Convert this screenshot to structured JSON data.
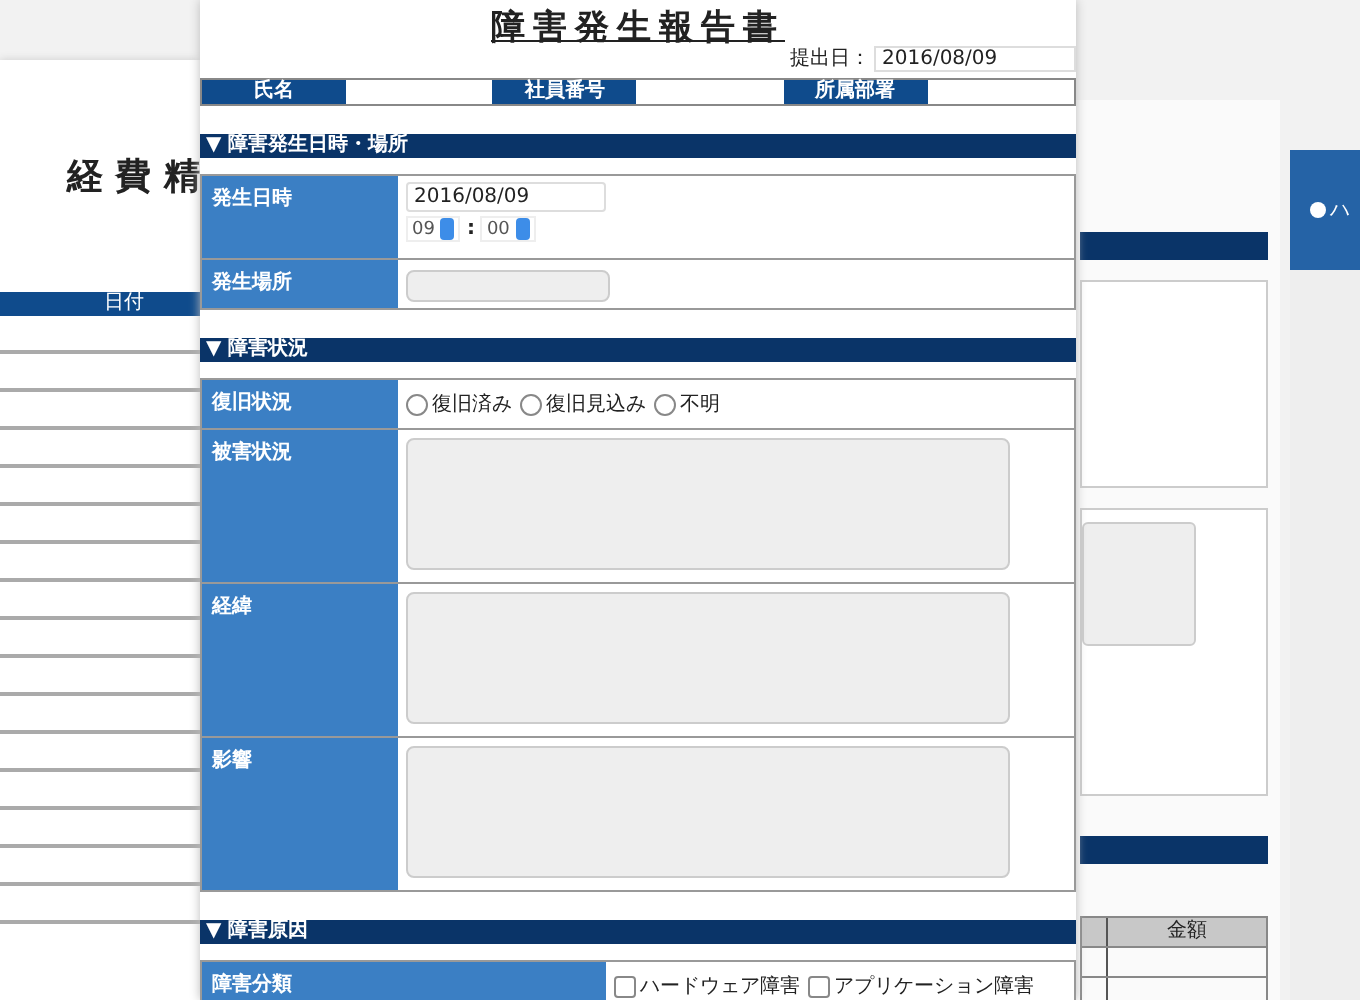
{
  "left_form": {
    "title": "経 費 精",
    "column": "日付"
  },
  "main_form": {
    "title": "障害発生報告書",
    "submit_label": "提出日：",
    "submit_date": "2016/08/09",
    "header_fields": [
      {
        "label": "氏名"
      },
      {
        "label": "社員番号"
      },
      {
        "label": "所属部署"
      }
    ],
    "sections": [
      {
        "heading": "▼ 障害発生日時・場所",
        "rows": [
          {
            "kind": "datetime",
            "label": "発生日時",
            "date": "2016/08/09",
            "hour": "09",
            "separator": ":",
            "minute": "00"
          },
          {
            "kind": "text",
            "label": "発生場所"
          }
        ]
      },
      {
        "heading": "▼ 障害状況",
        "rows": [
          {
            "kind": "radio",
            "label": "復旧状況",
            "options": [
              {
                "label": "復旧済み",
                "selected": false
              },
              {
                "label": "復旧見込み",
                "selected": false
              },
              {
                "label": "不明",
                "selected": false
              }
            ]
          },
          {
            "kind": "textarea",
            "label": "被害状況"
          },
          {
            "kind": "textarea",
            "label": "経緯"
          },
          {
            "kind": "textarea",
            "label": "影響"
          }
        ]
      },
      {
        "heading": "▼ 障害原因",
        "rows": [
          {
            "kind": "checkbox",
            "label": "障害分類",
            "options": [
              {
                "label": "ハードウェア障害",
                "checked": false
              },
              {
                "label": "アプリケーション障害",
                "checked": false
              }
            ]
          }
        ]
      }
    ]
  },
  "right_form": {
    "column": "金額"
  },
  "far_right_form": {
    "option": "ハ",
    "selected": false
  }
}
